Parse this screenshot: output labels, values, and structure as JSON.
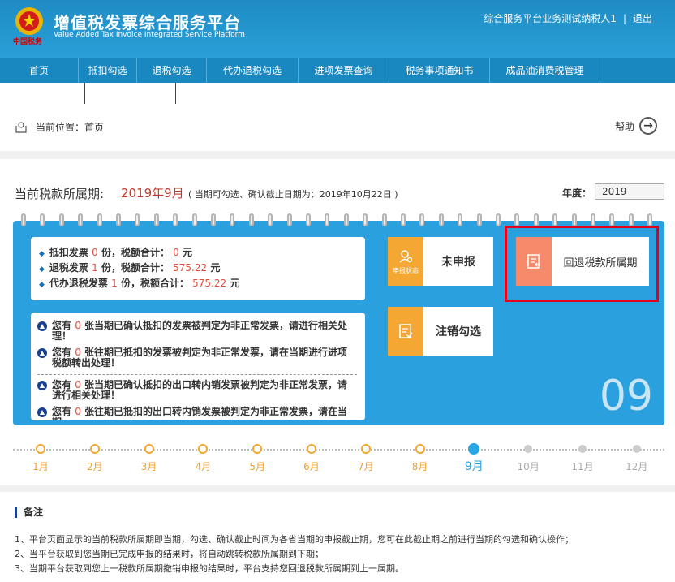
{
  "header": {
    "title_cn": "增值税发票综合服务平台",
    "title_en": "Value Added Tax Invoice Integrated Service Platform",
    "emblem_text": "中国税务",
    "user_name": "综合服务平台业务测试纳税人1",
    "separator": "|",
    "logout": "退出"
  },
  "nav": {
    "items": [
      {
        "label": "首页",
        "width": 0
      },
      {
        "label": "抵扣勾选"
      },
      {
        "label": "退税勾选"
      },
      {
        "label": "代办退税勾选"
      },
      {
        "label": "进项发票查询"
      },
      {
        "label": "税务事项通知书"
      },
      {
        "label": "成品油消费税管理"
      }
    ]
  },
  "breadcrumb": {
    "text": "当前位置：首页",
    "help": "帮助"
  },
  "period": {
    "label": "当前税款所属期:",
    "value": "2019年9月",
    "note": "( 当期可勾选、确认截止日期为：2019年10月22日 )",
    "year_label": "年度：",
    "year_value": "2019"
  },
  "summary": {
    "line1": {
      "prefix": "抵扣发票",
      "count": "0",
      "mid": "份，税额合计：",
      "amount": "0",
      "unit": "元"
    },
    "line2": {
      "prefix": "退税发票",
      "count": "1",
      "mid": "份，税额合计：",
      "amount": "575.22",
      "unit": "元"
    },
    "line3": {
      "prefix": "代办退税发票",
      "count": "1",
      "mid": "份，税额合计：",
      "amount": "575.22",
      "unit": "元"
    }
  },
  "notices": [
    {
      "pre": "您有",
      "count": "0",
      "text": "张当期已确认抵扣的发票被判定为非正常发票，请进行相关处理！"
    },
    {
      "pre": "您有",
      "count": "0",
      "text": "张往期已抵扣的发票被判定为非正常发票，请在当期进行进项税额转出处理！"
    },
    {
      "pre": "您有",
      "count": "0",
      "text": "张当期已确认抵扣的出口转内销发票被判定为非正常发票，请进行相关处理！"
    },
    {
      "pre": "您有",
      "count": "0",
      "text": "张往期已抵扣的出口转内销发票被判定为非正常发票，请在当期"
    }
  ],
  "tiles": {
    "status_icon_label": "申报状态",
    "status": "未申报",
    "cancel": "注销勾选",
    "rollback": "回退税款所属期"
  },
  "big_month": "09",
  "timeline": {
    "months": [
      "1月",
      "2月",
      "3月",
      "4月",
      "5月",
      "6月",
      "7月",
      "8月",
      "9月",
      "10月",
      "11月",
      "12月"
    ],
    "current_index": 8
  },
  "notes": {
    "title": "备注",
    "lines": [
      "1、平台页面显示的当前税款所属期即当期，勾选、确认截止时间为各省当期的申报截止期，您可在此截止期之前进行当期的勾选和确认操作；",
      "2、当平台获取到您当期已完成申报的结果时，将自动跳转税款所属期到下期；",
      "3、当期平台获取到您上一税款所属期撤销申报的结果时，平台支持您回退税款所属期到上一属期。"
    ]
  },
  "colors": {
    "accent": "#2ba0df",
    "orange": "#f4a833",
    "salmon": "#f88a6c",
    "red": "#e3001b"
  }
}
